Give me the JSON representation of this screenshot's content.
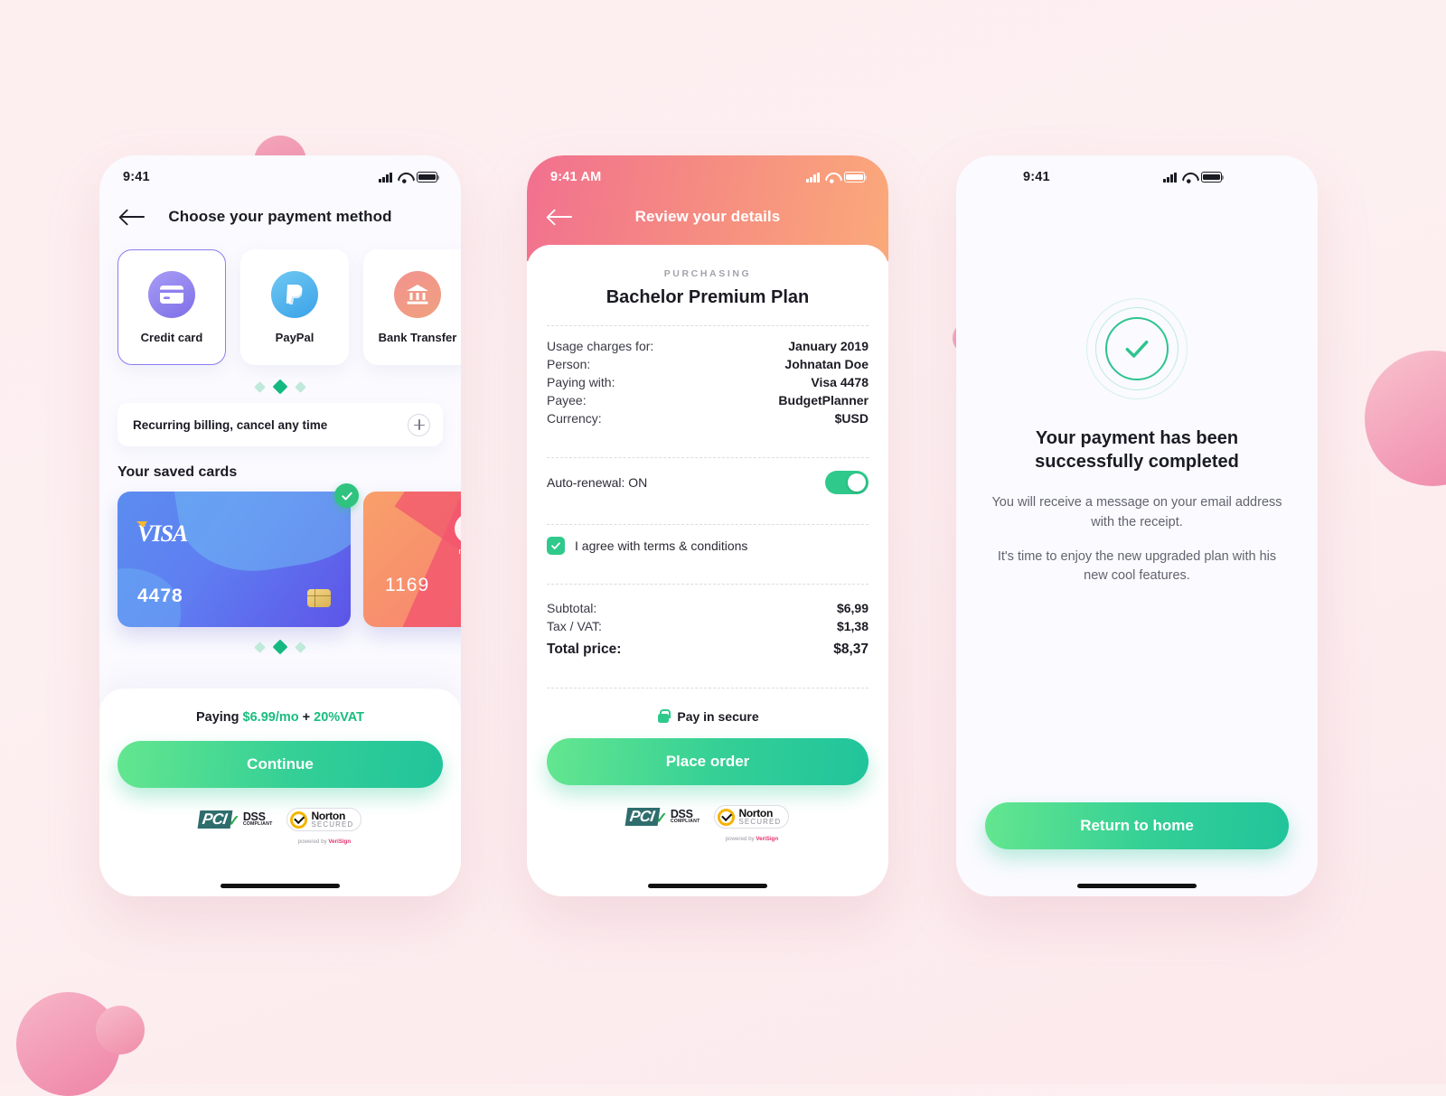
{
  "screens": {
    "payment_method": {
      "status_bar": {
        "time": "9:41",
        "icons": [
          "signal-icon",
          "wifi-icon",
          "battery-icon"
        ]
      },
      "nav": {
        "back_icon": "back-arrow-icon",
        "title": "Choose your payment method"
      },
      "methods": [
        {
          "label": "Credit card",
          "icon": "credit-card-icon",
          "selected": true
        },
        {
          "label": "PayPal",
          "icon": "paypal-icon",
          "selected": false
        },
        {
          "label": "Bank Transfer",
          "icon": "bank-icon",
          "selected": false
        }
      ],
      "methods_pager": {
        "count": 3,
        "active_index": 1
      },
      "recurring": {
        "label": "Recurring billing, cancel any time",
        "add_icon": "plus-icon"
      },
      "saved_cards_title": "Your saved cards",
      "cards": [
        {
          "brand": "VISA",
          "number": "4478",
          "selected": true,
          "check_icon": "check-circle-icon"
        },
        {
          "brand": "mastercard",
          "number": "1169",
          "selected": false
        }
      ],
      "cards_pager": {
        "count": 3,
        "active_index": 1
      },
      "paying": {
        "prefix": "Paying ",
        "amount": "$6.99/mo",
        "plus": " + ",
        "vat": "20%VAT"
      },
      "cta": "Continue",
      "badges": [
        {
          "name": "pci-dss-badge",
          "mark": "PCI",
          "line1": "DSS",
          "line2": "COMPLIANT"
        },
        {
          "name": "norton-secured-badge",
          "line1": "Norton",
          "line2": "SECURED",
          "sub_prefix": "powered by ",
          "sub_brand": "VeriSign"
        }
      ]
    },
    "review": {
      "status_bar": {
        "time": "9:41 AM",
        "icons": [
          "signal-icon",
          "wifi-icon",
          "battery-icon"
        ]
      },
      "nav": {
        "back_icon": "back-arrow-icon",
        "title": "Review your details"
      },
      "eyebrow": "PURCHASING",
      "plan_name": "Bachelor Premium Plan",
      "details": [
        {
          "key": "Usage charges for:",
          "value": "January 2019"
        },
        {
          "key": "Person:",
          "value": "Johnatan Doe"
        },
        {
          "key": "Paying with:",
          "value": "Visa 4478"
        },
        {
          "key": "Payee:",
          "value": "BudgetPlanner"
        },
        {
          "key": "Currency:",
          "value": "$USD"
        }
      ],
      "auto_renewal": {
        "label": "Auto-renewal: ON",
        "on": true
      },
      "terms": {
        "label": "I agree with terms & conditions",
        "checked": true,
        "check_icon": "check-icon"
      },
      "totals": [
        {
          "key": "Subtotal:",
          "value": "$6,99"
        },
        {
          "key": "Tax / VAT:",
          "value": "$1,38"
        }
      ],
      "total": {
        "key": "Total price:",
        "value": "$8,37"
      },
      "secure": {
        "icon": "lock-icon",
        "label": "Pay in secure"
      },
      "cta": "Place order",
      "badges": [
        {
          "name": "pci-dss-badge",
          "mark": "PCI",
          "line1": "DSS",
          "line2": "COMPLIANT"
        },
        {
          "name": "norton-secured-badge",
          "line1": "Norton",
          "line2": "SECURED",
          "sub_prefix": "powered by ",
          "sub_brand": "VeriSign"
        }
      ]
    },
    "success": {
      "status_bar": {
        "time": "9:41",
        "icons": [
          "signal-icon",
          "wifi-icon",
          "battery-icon"
        ]
      },
      "success_icon": "check-circle-icon",
      "title": "Your payment has been successfully completed",
      "paragraph_1": "You will receive a message on your email address with the receipt.",
      "paragraph_2": "It's time to enjoy the new upgraded plan with his new cool features.",
      "cta": "Return to home"
    }
  },
  "colors": {
    "page_background": "#fdeef0",
    "accent_green_light": "#64e68f",
    "accent_green_dark": "#21c49b",
    "selected_border": "#8b7ef0",
    "header_gradient_start": "#f1708f",
    "header_gradient_end": "#fba97a",
    "pager_active": "#14b981",
    "pager_inactive": "#bfe9d8",
    "toggle_on": "#2fc98c"
  }
}
